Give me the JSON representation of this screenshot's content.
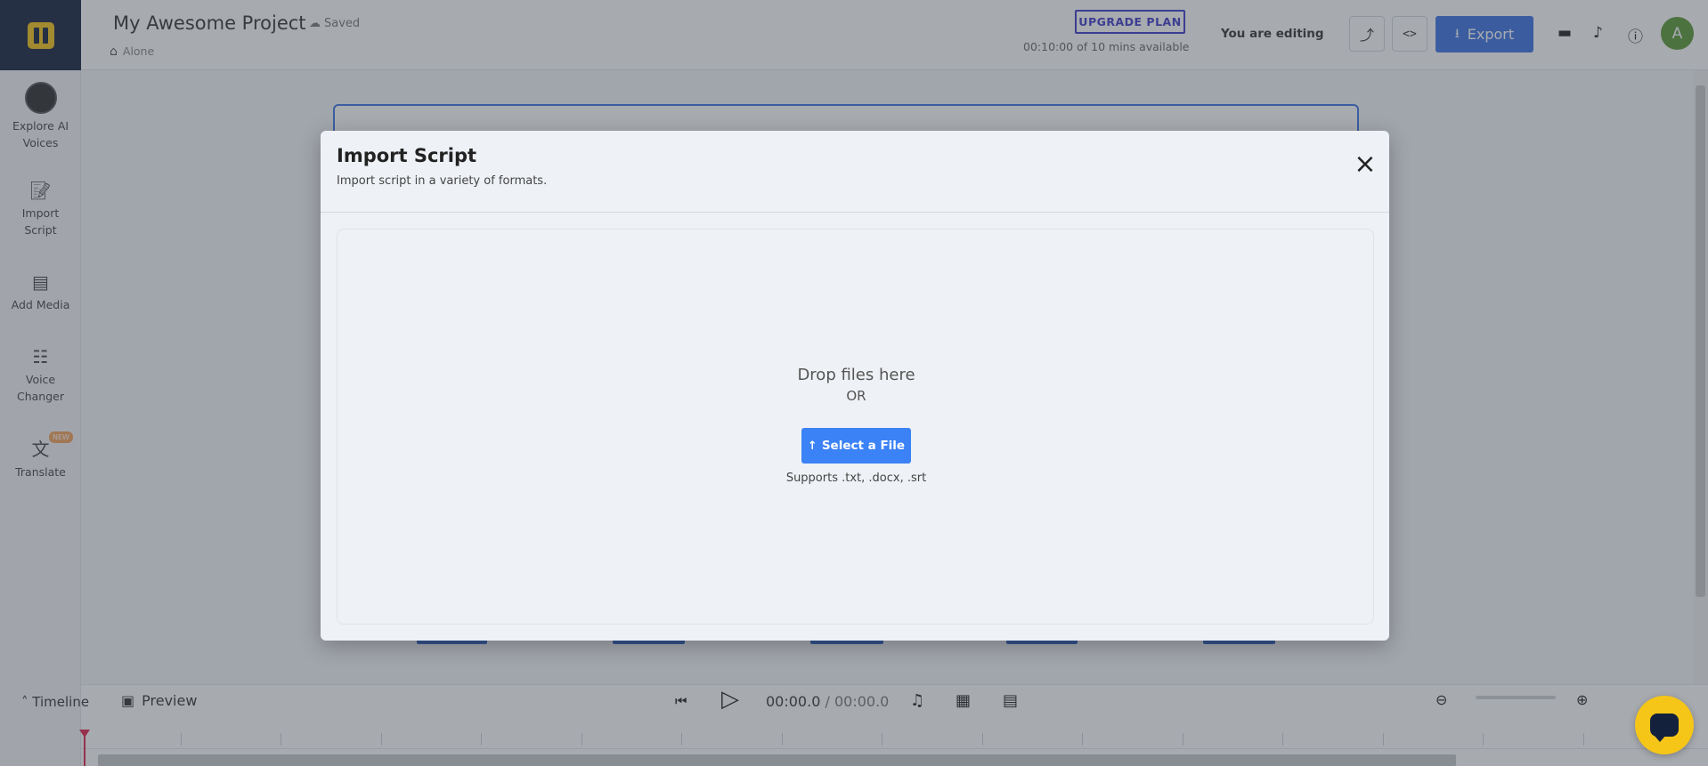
{
  "header": {
    "project_title": "My Awesome Project",
    "saved_status": "Saved",
    "breadcrumb": "Alone",
    "upgrade_label": "UPGRADE PLAN",
    "minutes_available": "00:10:00 of 10 mins available",
    "editing_status": "You are editing",
    "export_label": "Export",
    "user_initial": "A"
  },
  "sidebar": {
    "items": [
      {
        "label_line1": "Explore AI",
        "label_line2": "Voices",
        "icon": "ai-voice-avatar"
      },
      {
        "label_line1": "Import",
        "label_line2": "Script",
        "icon": "import-script-icon"
      },
      {
        "label_line1": "Add Media",
        "label_line2": "",
        "icon": "add-media-icon"
      },
      {
        "label_line1": "Voice",
        "label_line2": "Changer",
        "icon": "voice-changer-icon"
      },
      {
        "label_line1": "Translate",
        "label_line2": "",
        "icon": "translate-icon",
        "badge": "NEW"
      }
    ]
  },
  "bottombar": {
    "timeline_label": "Timeline",
    "preview_label": "Preview",
    "current_time": "00:00.0",
    "separator": "/",
    "duration": "00:00.0"
  },
  "modal": {
    "title": "Import Script",
    "subtitle": "Import script in a variety of formats.",
    "drop_text": "Drop files here",
    "or_text": "OR",
    "select_button": "Select a File",
    "supports_text": "Supports .txt, .docx, .srt"
  },
  "colors": {
    "accent": "#3b73e3",
    "select_button": "#3b82f6",
    "logo_bg": "#14213d",
    "brand_yellow": "#f5c518",
    "upgrade": "#3d3ac8",
    "playhead": "#e0244a"
  }
}
